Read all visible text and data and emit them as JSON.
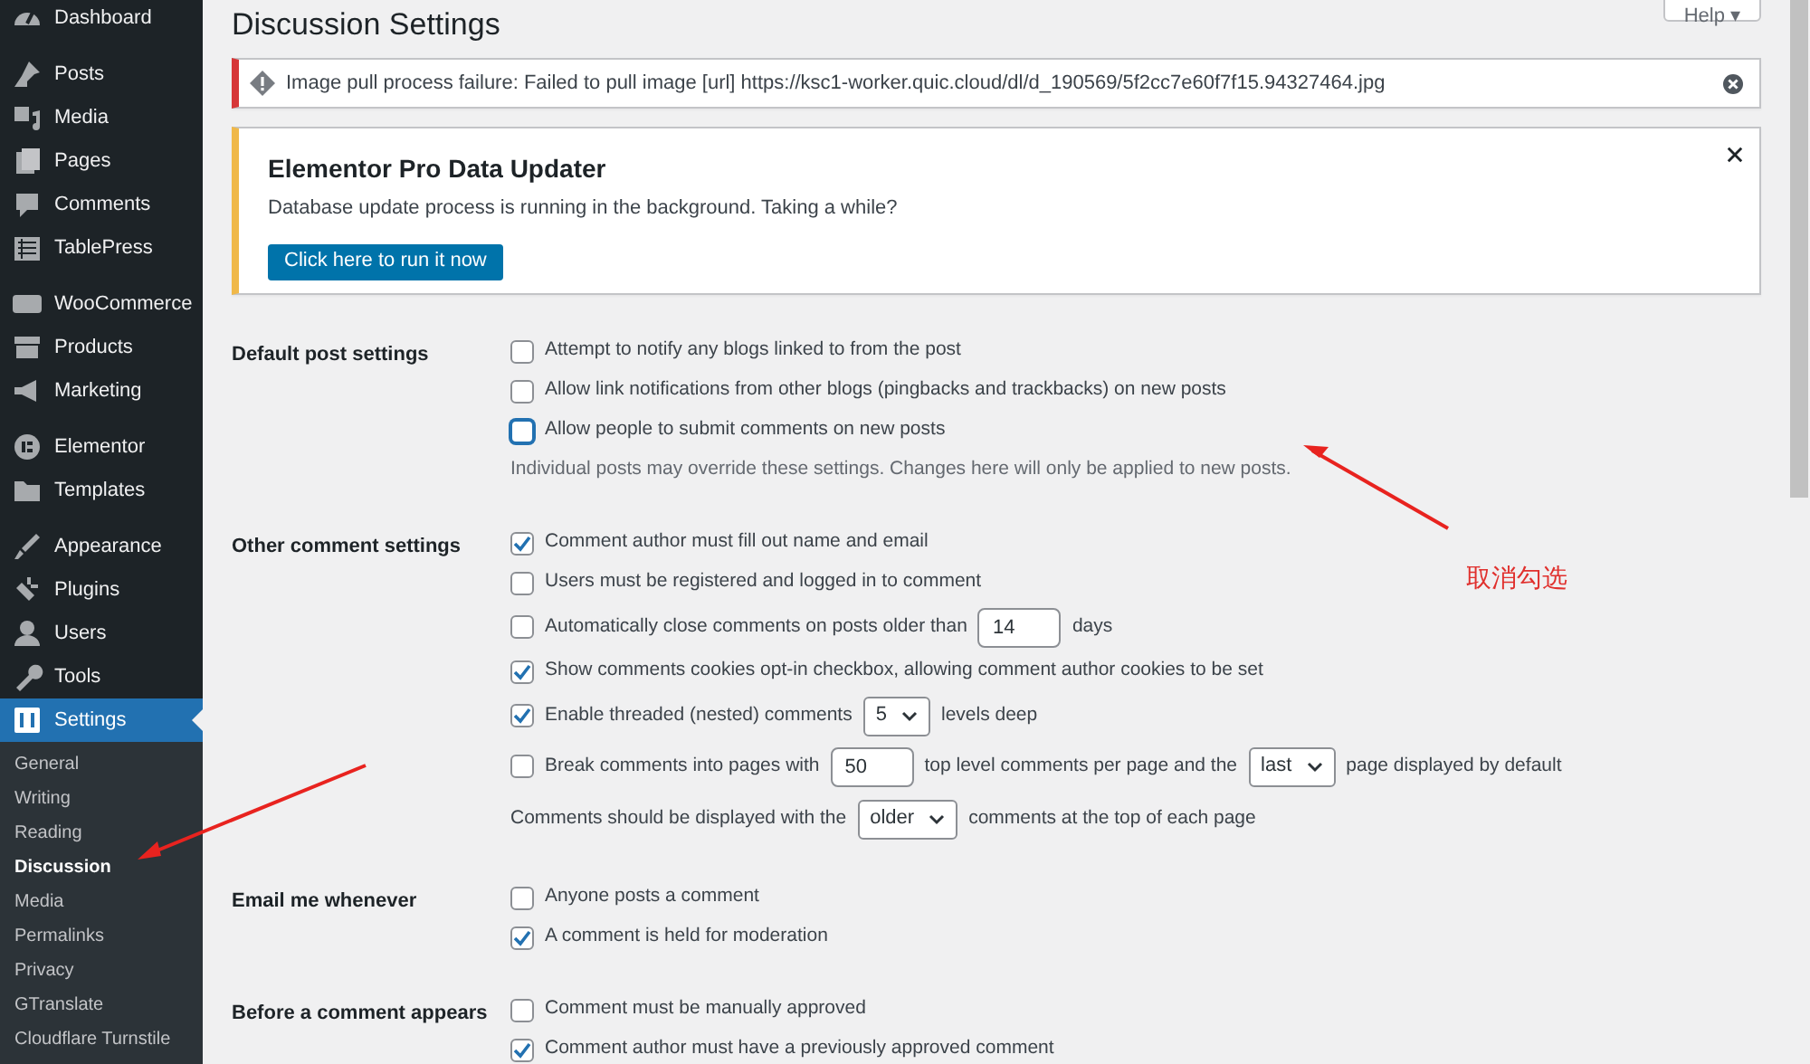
{
  "sidebar": {
    "groups": [
      [
        {
          "label": "Dashboard",
          "selected": false
        }
      ],
      [
        {
          "label": "Posts",
          "selected": false
        },
        {
          "label": "Media",
          "selected": false
        },
        {
          "label": "Pages",
          "selected": false
        },
        {
          "label": "Comments",
          "selected": false
        },
        {
          "label": "TablePress",
          "selected": false
        }
      ],
      [
        {
          "label": "WooCommerce",
          "selected": false
        },
        {
          "label": "Products",
          "selected": false
        },
        {
          "label": "Marketing",
          "selected": false
        }
      ],
      [
        {
          "label": "Elementor",
          "selected": false
        },
        {
          "label": "Templates",
          "selected": false
        }
      ],
      [
        {
          "label": "Appearance",
          "selected": false
        },
        {
          "label": "Plugins",
          "selected": false
        },
        {
          "label": "Users",
          "selected": false
        },
        {
          "label": "Tools",
          "selected": false
        },
        {
          "label": "Settings",
          "selected": true
        }
      ]
    ],
    "submenu": [
      {
        "label": "General",
        "selected": false
      },
      {
        "label": "Writing",
        "selected": false
      },
      {
        "label": "Reading",
        "selected": false
      },
      {
        "label": "Discussion",
        "selected": true
      },
      {
        "label": "Media",
        "selected": false
      },
      {
        "label": "Permalinks",
        "selected": false
      },
      {
        "label": "Privacy",
        "selected": false
      },
      {
        "label": "GTranslate",
        "selected": false
      },
      {
        "label": "Cloudflare Turnstile",
        "selected": false
      }
    ]
  },
  "page_title": "Discussion Settings",
  "help_button": "Help ▾",
  "notices": [
    {
      "kind": "error",
      "text": "Image pull process failure: Failed to pull image [url] https://ksc1-worker.quic.cloud/dl/d_190569/5f2cc7e60f7f15.94327464.jpg"
    },
    {
      "kind": "warning",
      "title": "Elementor Pro Data Updater",
      "text": "Database update process is running in the background. Taking a while?",
      "button": "Click here to run it now"
    }
  ],
  "sections": [
    {
      "label": "Default post settings",
      "rows": [
        {
          "kind": "checkbox",
          "checked": false,
          "parts": [
            {
              "kind": "text",
              "text": "Attempt to notify any blogs linked to from the post"
            }
          ]
        },
        {
          "kind": "checkbox",
          "checked": false,
          "parts": [
            {
              "kind": "text",
              "text": "Allow link notifications from other blogs (pingbacks and trackbacks) on new posts"
            }
          ]
        },
        {
          "kind": "checkbox",
          "checked": false,
          "focused": true,
          "parts": [
            {
              "kind": "text",
              "text": "Allow people to submit comments on new posts"
            }
          ]
        },
        {
          "kind": "description",
          "parts": [
            {
              "kind": "text",
              "text": "Individual posts may override these settings. Changes here will only be applied to new posts."
            }
          ]
        }
      ]
    },
    {
      "label": "Other comment settings",
      "rows": [
        {
          "kind": "checkbox",
          "checked": true,
          "parts": [
            {
              "kind": "text",
              "text": "Comment author must fill out name and email"
            }
          ]
        },
        {
          "kind": "checkbox",
          "checked": false,
          "parts": [
            {
              "kind": "text",
              "text": "Users must be registered and logged in to comment"
            }
          ]
        },
        {
          "kind": "checkbox",
          "checked": false,
          "parts": [
            {
              "kind": "text",
              "text": "Automatically close comments on posts older than"
            },
            {
              "kind": "input",
              "value": "14"
            },
            {
              "kind": "text",
              "text": "days"
            }
          ]
        },
        {
          "kind": "checkbox",
          "checked": true,
          "parts": [
            {
              "kind": "text",
              "text": "Show comments cookies opt-in checkbox, allowing comment author cookies to be set"
            }
          ]
        },
        {
          "kind": "checkbox",
          "checked": true,
          "parts": [
            {
              "kind": "text",
              "text": "Enable threaded (nested) comments"
            },
            {
              "kind": "select",
              "value": "5"
            },
            {
              "kind": "text",
              "text": "levels deep"
            }
          ]
        },
        {
          "kind": "checkbox",
          "checked": false,
          "parts": [
            {
              "kind": "text",
              "text": "Break comments into pages with"
            },
            {
              "kind": "input",
              "value": "50"
            },
            {
              "kind": "text",
              "text": "top level comments per page and the"
            },
            {
              "kind": "select",
              "value": "last"
            },
            {
              "kind": "text",
              "text": "page displayed by default"
            }
          ]
        },
        {
          "kind": "line",
          "parts": [
            {
              "kind": "text",
              "text": "Comments should be displayed with the"
            },
            {
              "kind": "select",
              "value": "older"
            },
            {
              "kind": "text",
              "text": "comments at the top of each page"
            }
          ]
        }
      ]
    },
    {
      "label": "Email me whenever",
      "rows": [
        {
          "kind": "checkbox",
          "checked": false,
          "parts": [
            {
              "kind": "text",
              "text": "Anyone posts a comment"
            }
          ]
        },
        {
          "kind": "checkbox",
          "checked": true,
          "parts": [
            {
              "kind": "text",
              "text": "A comment is held for moderation"
            }
          ]
        }
      ]
    },
    {
      "label": "Before a comment appears",
      "rows": [
        {
          "kind": "checkbox",
          "checked": false,
          "parts": [
            {
              "kind": "text",
              "text": "Comment must be manually approved"
            }
          ]
        },
        {
          "kind": "checkbox",
          "checked": true,
          "parts": [
            {
              "kind": "text",
              "text": "Comment author must have a previously approved comment"
            }
          ]
        }
      ]
    }
  ],
  "annotation": {
    "text": "取消勾选"
  }
}
